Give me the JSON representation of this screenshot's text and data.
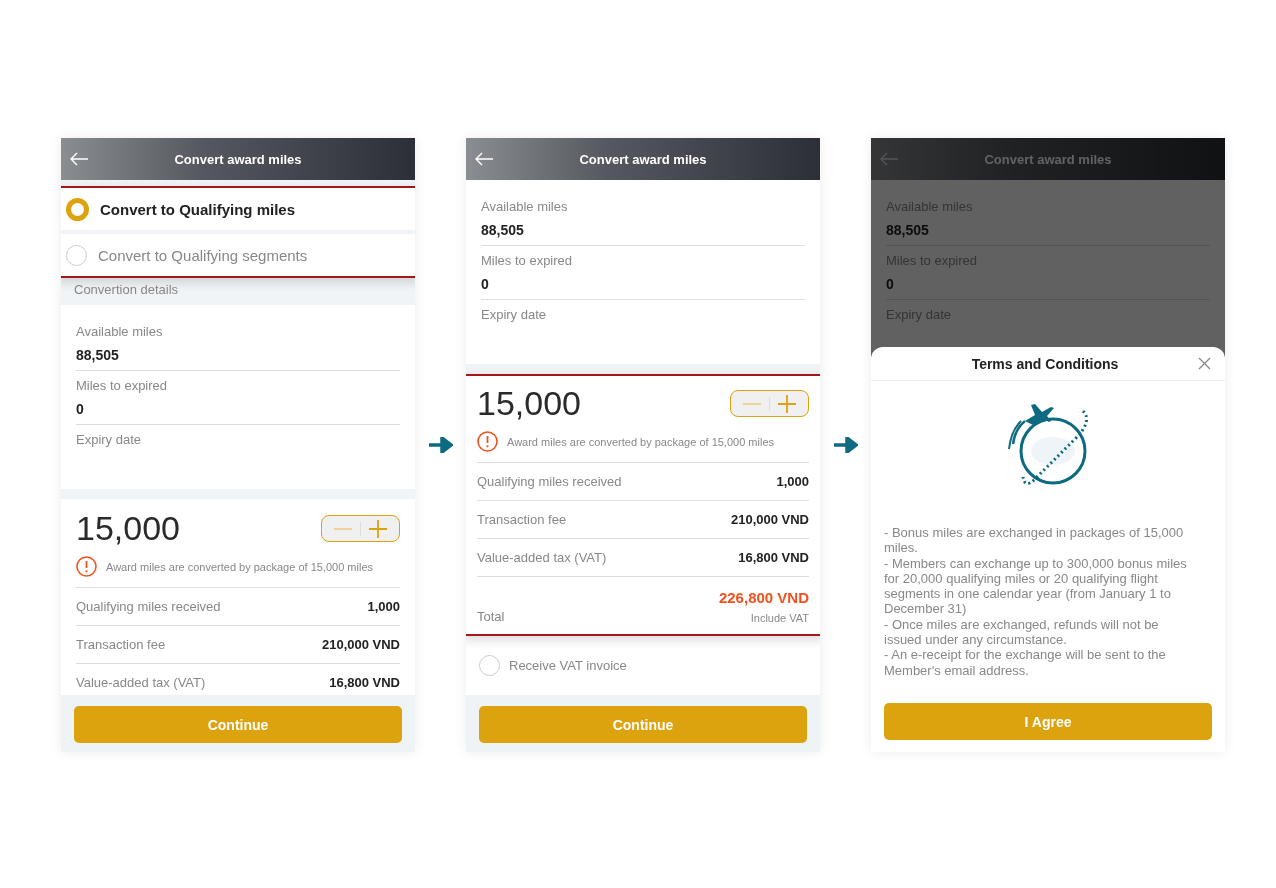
{
  "screens": [
    {
      "title": "Convert award miles",
      "options_highlighted": true,
      "options": [
        {
          "label": "Convert to Qualifying miles",
          "selected": true
        },
        {
          "label": "Convert to Qualifying segments",
          "selected": false
        }
      ],
      "section_label": "Convertion details",
      "details": [
        {
          "label": "Available miles",
          "value": "88,505"
        },
        {
          "label": "Miles to expired",
          "value": "0"
        },
        {
          "label": "Expiry date"
        }
      ],
      "converter": {
        "highlighted": false,
        "amount": "15,000",
        "note": "Award miles are converted by package of 15,000 miles",
        "rows": [
          {
            "label": "Qualifying miles received",
            "value": "1,000"
          },
          {
            "label": "Transaction fee",
            "value": "210,000 VND"
          },
          {
            "label": "Value-added tax (VAT)",
            "value": "16,800 VND"
          }
        ]
      },
      "button": "Continue"
    },
    {
      "title": "Convert award miles",
      "details": [
        {
          "label": "Available miles",
          "value": "88,505"
        },
        {
          "label": "Miles to expired",
          "value": "0"
        },
        {
          "label": "Expiry date"
        }
      ],
      "converter": {
        "highlighted": true,
        "amount": "15,000",
        "note": "Award miles are converted by package of 15,000 miles",
        "rows": [
          {
            "label": "Qualifying miles received",
            "value": "1,000"
          },
          {
            "label": "Transaction fee",
            "value": "210,000 VND"
          },
          {
            "label": "Value-added tax (VAT)",
            "value": "16,800 VND"
          }
        ],
        "total": {
          "label": "Total",
          "value": "226,800 VND",
          "note": "Include VAT"
        }
      },
      "vat_invoice": {
        "label": "Receive VAT invoice",
        "checked": false
      },
      "button": "Continue"
    },
    {
      "title": "Convert award miles",
      "details": [
        {
          "label": "Available miles",
          "value": "88,505"
        },
        {
          "label": "Miles to expired",
          "value": "0"
        },
        {
          "label": "Expiry date"
        }
      ],
      "dialog": {
        "title": "Terms and Conditions",
        "terms": [
          "- Bonus miles are exchanged in packages of 15,000 miles.",
          "- Members can exchange up to 300,000 bonus miles for 20,000 qualifying miles or 20 qualifying flight segments in one calendar year (from January 1 to December 31)",
          "- Once miles are exchanged, refunds will not be issued under any circumstance.",
          "- An e-receipt for the exchange will be sent to the Member's email address."
        ],
        "button": "I Agree"
      }
    }
  ]
}
